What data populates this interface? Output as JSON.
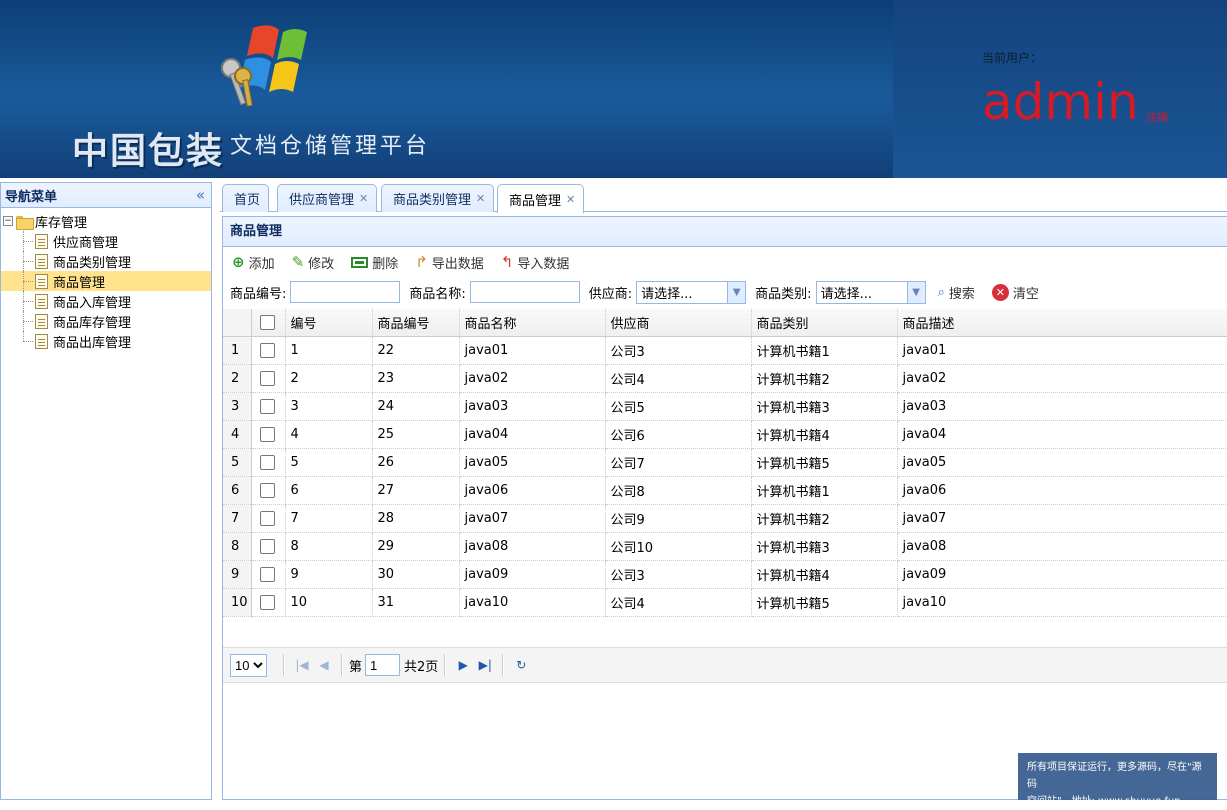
{
  "header": {
    "brand": "中国包装",
    "subtitle": "文档仓储管理平台",
    "user_label": "当前用户：",
    "username": "admin",
    "logout_label": "注销"
  },
  "sidebar": {
    "title": "导航菜单",
    "collapse_icon": "«",
    "root_label": "库存管理",
    "items": [
      {
        "label": "供应商管理"
      },
      {
        "label": "商品类别管理"
      },
      {
        "label": "商品管理"
      },
      {
        "label": "商品入库管理"
      },
      {
        "label": "商品库存管理"
      },
      {
        "label": "商品出库管理"
      }
    ],
    "selected_index": 2
  },
  "tabs": [
    {
      "label": "首页",
      "closable": false
    },
    {
      "label": "供应商管理",
      "closable": true
    },
    {
      "label": "商品类别管理",
      "closable": true
    },
    {
      "label": "商品管理",
      "closable": true,
      "active": true
    }
  ],
  "panel": {
    "title": "商品管理",
    "toolbar": {
      "add": "添加",
      "edit": "修改",
      "delete": "删除",
      "export": "导出数据",
      "import": "导入数据"
    },
    "search": {
      "code_label": "商品编号:",
      "name_label": "商品名称:",
      "supplier_label": "供应商:",
      "supplier_value": "请选择...",
      "category_label": "商品类别:",
      "category_value": "请选择...",
      "search_button": "搜索",
      "clear_button": "清空"
    },
    "grid": {
      "columns": [
        "编号",
        "商品编号",
        "商品名称",
        "供应商",
        "商品类别",
        "商品描述"
      ],
      "rows": [
        [
          "1",
          "22",
          "java01",
          "公司3",
          "计算机书籍1",
          "java01"
        ],
        [
          "2",
          "23",
          "java02",
          "公司4",
          "计算机书籍2",
          "java02"
        ],
        [
          "3",
          "24",
          "java03",
          "公司5",
          "计算机书籍3",
          "java03"
        ],
        [
          "4",
          "25",
          "java04",
          "公司6",
          "计算机书籍4",
          "java04"
        ],
        [
          "5",
          "26",
          "java05",
          "公司7",
          "计算机书籍5",
          "java05"
        ],
        [
          "6",
          "27",
          "java06",
          "公司8",
          "计算机书籍1",
          "java06"
        ],
        [
          "7",
          "28",
          "java07",
          "公司9",
          "计算机书籍2",
          "java07"
        ],
        [
          "8",
          "29",
          "java08",
          "公司10",
          "计算机书籍3",
          "java08"
        ],
        [
          "9",
          "30",
          "java09",
          "公司3",
          "计算机书籍4",
          "java09"
        ],
        [
          "10",
          "31",
          "java10",
          "公司4",
          "计算机书籍5",
          "java10"
        ]
      ]
    },
    "pager": {
      "page_size": "10",
      "page_prefix": "第",
      "page_number": "1",
      "page_total": "共2页"
    }
  },
  "watermark": {
    "line1": "所有项目保证运行，更多源码，尽在\"源码",
    "line2": "空间站\"，地址: www.shuyue.fun"
  },
  "colors": {
    "header_bg": "#1a5b9c",
    "username": "#d41b26",
    "border": "#95b8e7",
    "selected_row": "#ffe48d"
  }
}
